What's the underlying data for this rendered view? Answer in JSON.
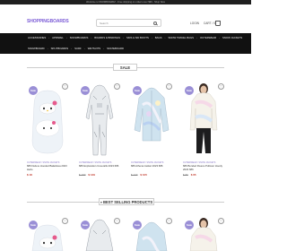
{
  "topbar": {
    "text": "Welcome to SNOWBOARDZ - Free shipping on orders over $99 - Shop Now"
  },
  "header": {
    "logo": "SHOPPINGBOARDS",
    "search_placeholder": "Search",
    "login": "LOGIN",
    "cart": "CART / 0"
  },
  "nav": {
    "row1": [
      "ACCESSORIES",
      "APPAREL",
      "SNOWBOARDS",
      "BOARDS & BINDINGS",
      "SKIS & SKI BOOTS",
      "BAGS",
      "SNOW TRAVEL BAGS",
      "OUTERWEAR",
      "SNOW JACKETS"
    ],
    "row2": [
      "SNOWBOARD",
      "SPLITBOARDS",
      "SURF",
      "WETSUITS",
      "SKATEBOARD"
    ]
  },
  "sale": {
    "heading": "SALE"
  },
  "products": [
    {
      "badge": "Sale",
      "brand": "OUTERWEAR / SNOW JACKETS",
      "title": "686 Deluxe Hooded Balaclava 2023 Hello",
      "old_price": "",
      "new_price": "$ 18"
    },
    {
      "badge": "Sale",
      "brand": "OUTERWEAR / SNOW JACKETS",
      "title": "686 Exploration Coveralls 2023 686",
      "old_price": "$ 189",
      "new_price": "$ 139"
    },
    {
      "badge": "Sale",
      "brand": "OUTERWEAR / SNOW JACKETS",
      "title": "686 Athena Jacket 2023 686",
      "old_price": "$ 139",
      "new_price": "$ 105"
    },
    {
      "badge": "Sale",
      "brand": "OUTERWEAR / SNOW JACKETS",
      "title": "686 Bonded Fleece Pullover Hoody 2023 686",
      "old_price": "$ 89",
      "new_price": "$ 65"
    }
  ],
  "best": {
    "heading": "BEST SELLING PRODUCTS"
  },
  "best_products": [
    {
      "badge": "Sale"
    },
    {
      "badge": "Sale"
    },
    {
      "badge": "Sale"
    },
    {
      "badge": "Sale"
    }
  ]
}
